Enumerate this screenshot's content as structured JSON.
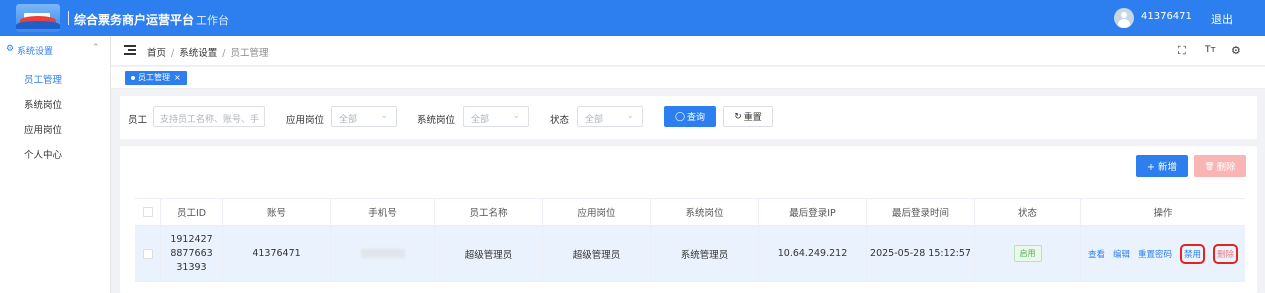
{
  "header": {
    "title": "综合票务商户运营平台",
    "workbench": "工作台",
    "username": "41376471",
    "logout": "退出"
  },
  "sidebar": {
    "group_icon": "⚙",
    "group": "系统设置",
    "items": [
      {
        "label": "员工管理",
        "active": true
      },
      {
        "label": "系统岗位",
        "active": false
      },
      {
        "label": "应用岗位",
        "active": false
      },
      {
        "label": "个人中心",
        "active": false
      }
    ]
  },
  "breadcrumb": {
    "home": "首页",
    "level1": "系统设置",
    "current": "员工管理",
    "separator": "/"
  },
  "topbar_icons": {
    "fullscreen": "⛶",
    "font_size": "Tт",
    "settings": "⚙"
  },
  "tags": [
    {
      "label": "员工管理"
    }
  ],
  "search": {
    "employee_label": "员工",
    "employee_placeholder": "支持员工名称、账号、手",
    "app_post_label": "应用岗位",
    "app_post_value": "全部",
    "sys_post_label": "系统岗位",
    "sys_post_value": "全部",
    "status_label": "状态",
    "status_value": "全部",
    "query_icon": "◯",
    "query_button": "查询",
    "reset_icon": "↻",
    "reset_button": "重置"
  },
  "actions": {
    "add_button": "+ 新增",
    "delete_button": "删除",
    "delete_icon": "🗑"
  },
  "table": {
    "columns": [
      "员工ID",
      "账号",
      "手机号",
      "员工名称",
      "应用岗位",
      "系统岗位",
      "最后登录IP",
      "最后登录时间",
      "状态",
      "操作"
    ],
    "rows": [
      {
        "id_line1": "1912427",
        "id_line2": "8877663",
        "id_line3": "31393",
        "account": "41376471",
        "phone": "",
        "name": "超级管理员",
        "app_post": "超级管理员",
        "sys_post": "系统管理员",
        "last_ip": "10.64.249.212",
        "last_login": "2025-05-28 15:12:57",
        "status": "启用",
        "ops": {
          "view": "查看",
          "edit": "编辑",
          "reset_password": "重置密码",
          "disable": "禁用",
          "delete": "删除"
        }
      }
    ]
  },
  "colors": {
    "primary": "#2d7ff0",
    "danger_highlight": "#e0241f",
    "status_green": "#52b152"
  }
}
